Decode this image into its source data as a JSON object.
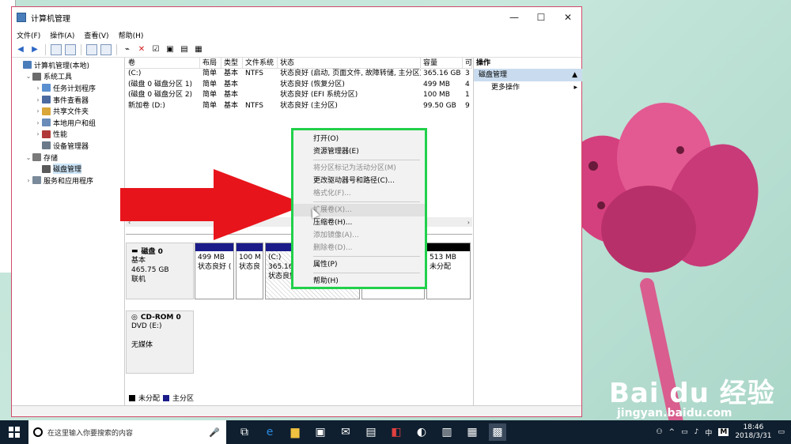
{
  "window": {
    "title": "计算机管理",
    "minimize_glyph": "—",
    "maximize_glyph": "☐",
    "close_glyph": "✕"
  },
  "menu": [
    "文件(F)",
    "操作(A)",
    "查看(V)",
    "帮助(H)"
  ],
  "tree": [
    {
      "label": "计算机管理(本地)",
      "indent": 0,
      "arrow": "",
      "icon": "#4a7ebb"
    },
    {
      "label": "系统工具",
      "indent": 1,
      "arrow": "⌄",
      "icon": "#6b6b6b"
    },
    {
      "label": "任务计划程序",
      "indent": 2,
      "arrow": "›",
      "icon": "#5a8fd0"
    },
    {
      "label": "事件查看器",
      "indent": 2,
      "arrow": "›",
      "icon": "#4a6aa0"
    },
    {
      "label": "共享文件夹",
      "indent": 2,
      "arrow": "›",
      "icon": "#d9a63a"
    },
    {
      "label": "本地用户和组",
      "indent": 2,
      "arrow": "›",
      "icon": "#6a8cb8"
    },
    {
      "label": "性能",
      "indent": 2,
      "arrow": "›",
      "icon": "#b03a3a"
    },
    {
      "label": "设备管理器",
      "indent": 2,
      "arrow": "",
      "icon": "#6a7a8a"
    },
    {
      "label": "存储",
      "indent": 1,
      "arrow": "⌄",
      "icon": "#7a7a7a"
    },
    {
      "label": "磁盘管理",
      "indent": 2,
      "arrow": "",
      "icon": "#5a5a5a",
      "selected": true
    },
    {
      "label": "服务和应用程序",
      "indent": 1,
      "arrow": "›",
      "icon": "#7a8a9a"
    }
  ],
  "volumes": {
    "headers": [
      "卷",
      "布局",
      "类型",
      "文件系统",
      "状态",
      "容量",
      "可"
    ],
    "rows": [
      [
        "(C:)",
        "简单",
        "基本",
        "NTFS",
        "状态良好 (启动, 页面文件, 故障转储, 主分区)",
        "365.16 GB",
        "3"
      ],
      [
        "(磁盘 0 磁盘分区 1)",
        "简单",
        "基本",
        "",
        "状态良好 (恢复分区)",
        "499 MB",
        "4"
      ],
      [
        "(磁盘 0 磁盘分区 2)",
        "简单",
        "基本",
        "",
        "状态良好 (EFI 系统分区)",
        "100 MB",
        "1"
      ],
      [
        "新加卷 (D:)",
        "简单",
        "基本",
        "NTFS",
        "状态良好 (主分区)",
        "99.50 GB",
        "9"
      ]
    ]
  },
  "disks": {
    "disk0": {
      "name": "磁盘 0",
      "type": "基本",
      "size": "465.75 GB",
      "status": "联机"
    },
    "cdrom": {
      "name": "CD-ROM 0",
      "drive": "DVD (E:)",
      "media": "无媒体"
    },
    "partitions": [
      {
        "size": "499 MB",
        "status": "状态良好 ("
      },
      {
        "size": "100 M",
        "status": "状态良"
      },
      {
        "label": "(C:)",
        "size": "365.16",
        "status": "状态良好"
      },
      {
        "size": "513 MB",
        "status": "未分配"
      }
    ]
  },
  "legend": {
    "unallocated": "未分配",
    "primary": "主分区"
  },
  "actions": {
    "title": "操作",
    "section": "磁盘管理",
    "more": "更多操作"
  },
  "context_menu": [
    {
      "label": "打开(O)",
      "disabled": false
    },
    {
      "label": "资源管理器(E)",
      "disabled": false
    },
    {
      "sep": true
    },
    {
      "label": "将分区标记为活动分区(M)",
      "disabled": true
    },
    {
      "label": "更改驱动器号和路径(C)...",
      "disabled": false
    },
    {
      "label": "格式化(F)...",
      "disabled": true
    },
    {
      "sep": true
    },
    {
      "label": "扩展卷(X)...",
      "disabled": true,
      "highlight": true
    },
    {
      "label": "压缩卷(H)...",
      "disabled": false
    },
    {
      "label": "添加镜像(A)...",
      "disabled": true
    },
    {
      "label": "删除卷(D)...",
      "disabled": true
    },
    {
      "sep": true
    },
    {
      "label": "属性(P)",
      "disabled": false
    },
    {
      "sep": true
    },
    {
      "label": "帮助(H)",
      "disabled": false
    }
  ],
  "taskbar": {
    "search_placeholder": "在这里输入你要搜索的内容",
    "ime": "中",
    "ime2": "M",
    "time": "18:46",
    "date": "2018/3/31"
  },
  "watermark": {
    "logo": "Bai du 经验",
    "sub": "jingyan.baidu.com"
  },
  "colors": {
    "accent_green": "#21d04a",
    "arrow_red": "#e8141b",
    "primary_partition": "#1b1c8a"
  }
}
